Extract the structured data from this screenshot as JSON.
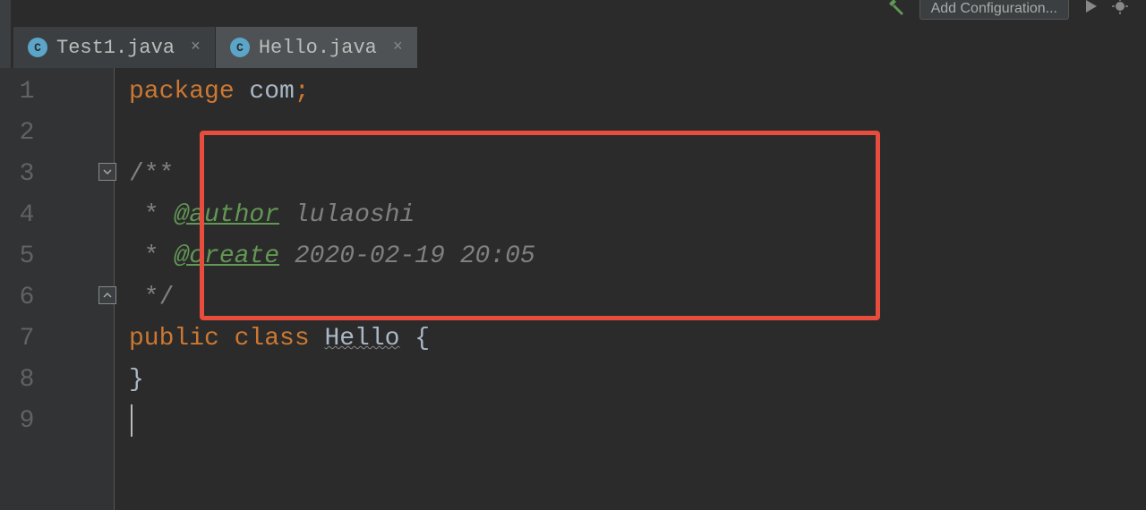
{
  "toolbar": {
    "add_config_label": "Add Configuration..."
  },
  "tabs": [
    {
      "icon_letter": "C",
      "label": "Test1.java",
      "active": false
    },
    {
      "icon_letter": "C",
      "label": "Hello.java",
      "active": true
    }
  ],
  "gutter": {
    "line_numbers": [
      "1",
      "2",
      "3",
      "4",
      "5",
      "6",
      "7",
      "8",
      "9"
    ]
  },
  "code": {
    "line1": {
      "keyword": "package ",
      "name": "com",
      "punct": ";"
    },
    "line3": {
      "comment_open": "/**"
    },
    "line4": {
      "star": " * ",
      "tag": "@author",
      "space": " ",
      "value": "lulaoshi"
    },
    "line5": {
      "star": " * ",
      "tag": "@create",
      "space": " ",
      "value": "2020-02-19 20:05"
    },
    "line6": {
      "comment_close": " */"
    },
    "line7": {
      "keyword1": "public ",
      "keyword2": "class ",
      "class_name": "Hello",
      "brace": " {"
    },
    "line8": {
      "brace": "}"
    }
  }
}
